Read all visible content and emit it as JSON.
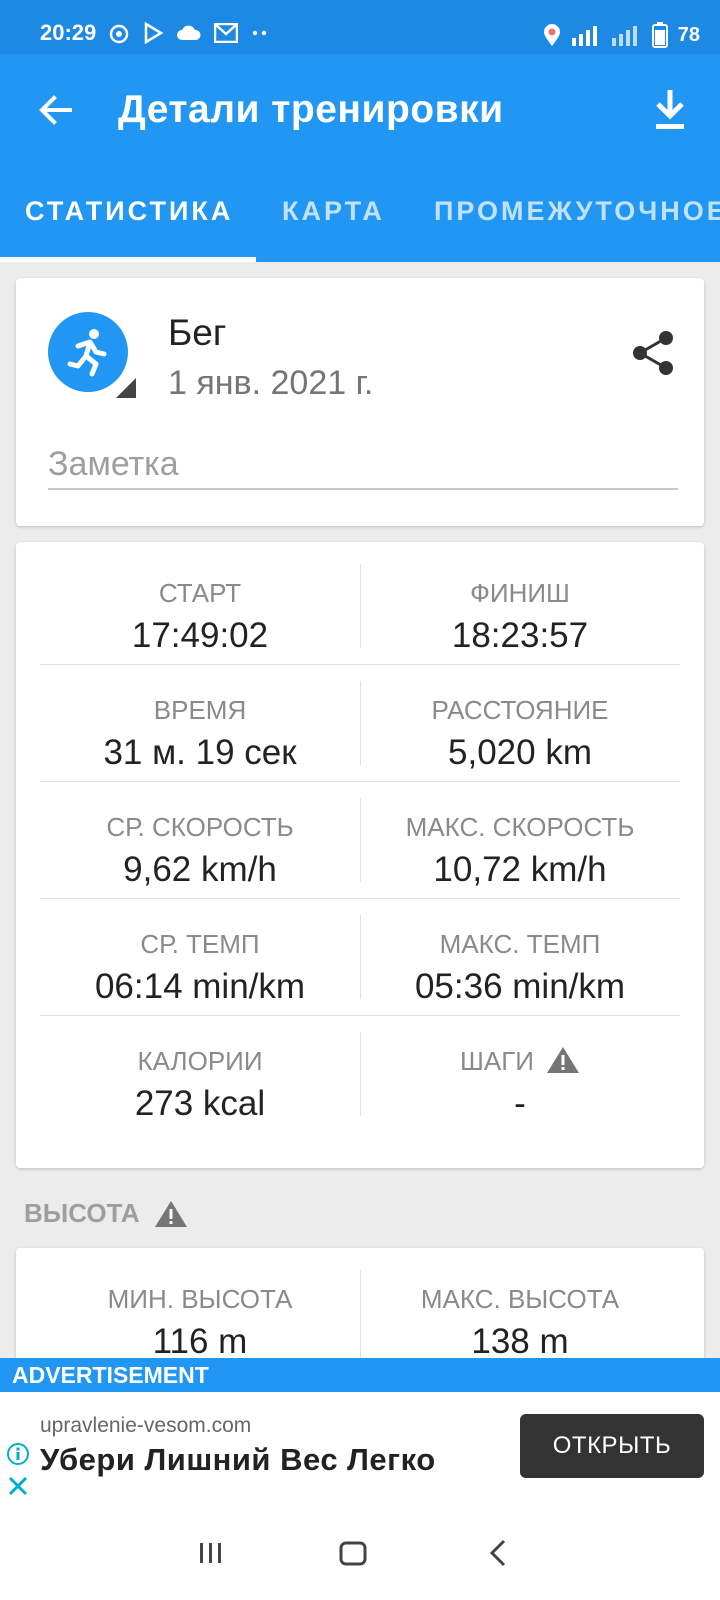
{
  "status_bar": {
    "time": "20:29",
    "battery": "78",
    "icons_left": [
      "alarm-icon",
      "play-store-icon",
      "cloud-icon",
      "gmail-icon",
      "more-dots-icon"
    ],
    "icons_right": [
      "location-icon",
      "signal-icon",
      "signal-2-icon",
      "battery-icon"
    ]
  },
  "app_bar": {
    "title": "Детали тренировки",
    "back_icon": "arrow-back-icon",
    "download_icon": "download-icon"
  },
  "tabs": [
    {
      "label": "СТАТИСТИКА",
      "active": true
    },
    {
      "label": "КАРТА",
      "active": false
    },
    {
      "label": "ПРОМЕЖУТОЧНОЕ",
      "active": false
    }
  ],
  "workout": {
    "name": "Бег",
    "date": "1 янв. 2021 г.",
    "note_placeholder": "Заметка",
    "icon": "running-icon",
    "accent_color": "#2196f3"
  },
  "stats": [
    {
      "left": {
        "label": "СТАРТ",
        "value": "17:49:02"
      },
      "right": {
        "label": "ФИНИШ",
        "value": "18:23:57"
      }
    },
    {
      "left": {
        "label": "ВРЕМЯ",
        "value": "31 м. 19 сек"
      },
      "right": {
        "label": "РАССТОЯНИЕ",
        "value": "5,020 km"
      }
    },
    {
      "left": {
        "label": "СР. СКОРОСТЬ",
        "value": "9,62 km/h"
      },
      "right": {
        "label": "МАКС. СКОРОСТЬ",
        "value": "10,72 km/h"
      }
    },
    {
      "left": {
        "label": "СР. ТЕМП",
        "value": "06:14 min/km"
      },
      "right": {
        "label": "МАКС. ТЕМП",
        "value": "05:36 min/km"
      }
    },
    {
      "left": {
        "label": "КАЛОРИИ",
        "value": "273 kcal"
      },
      "right": {
        "label": "ШАГИ",
        "value": "-"
      }
    }
  ],
  "altitude": {
    "heading": "ВЫСОТА",
    "min_label": "МИН. ВЫСОТА",
    "min_value": "116 m",
    "max_label": "МАКС. ВЫСОТА",
    "max_value": "138 m"
  },
  "ad": {
    "label": "ADVERTISEMENT",
    "domain": "upravlenie-vesom.com",
    "headline": "Убери Лишний Вес Легко",
    "button": "ОТКРЫТЬ"
  },
  "colors": {
    "primary": "#2196f3",
    "status_bar": "#1e88e5"
  }
}
